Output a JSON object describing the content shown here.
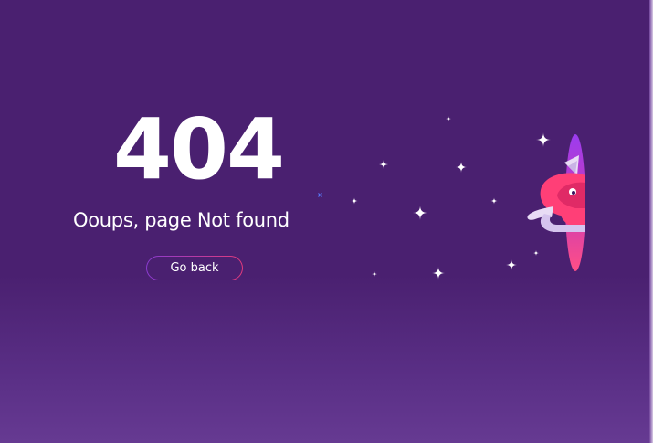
{
  "error": {
    "code": "404",
    "message": "Ooups, page Not found"
  },
  "actions": {
    "back_label": "Go back"
  },
  "colors": {
    "background": "#4a2070",
    "text": "#ffffff",
    "button_border_start": "#8a3bd0",
    "button_border_end": "#e23a7c",
    "portal": "#e23a7c",
    "figure": "#ff3f77"
  },
  "icons": {
    "sparkles": "sparkle-icon",
    "illustration": "portal-character-illustration"
  }
}
